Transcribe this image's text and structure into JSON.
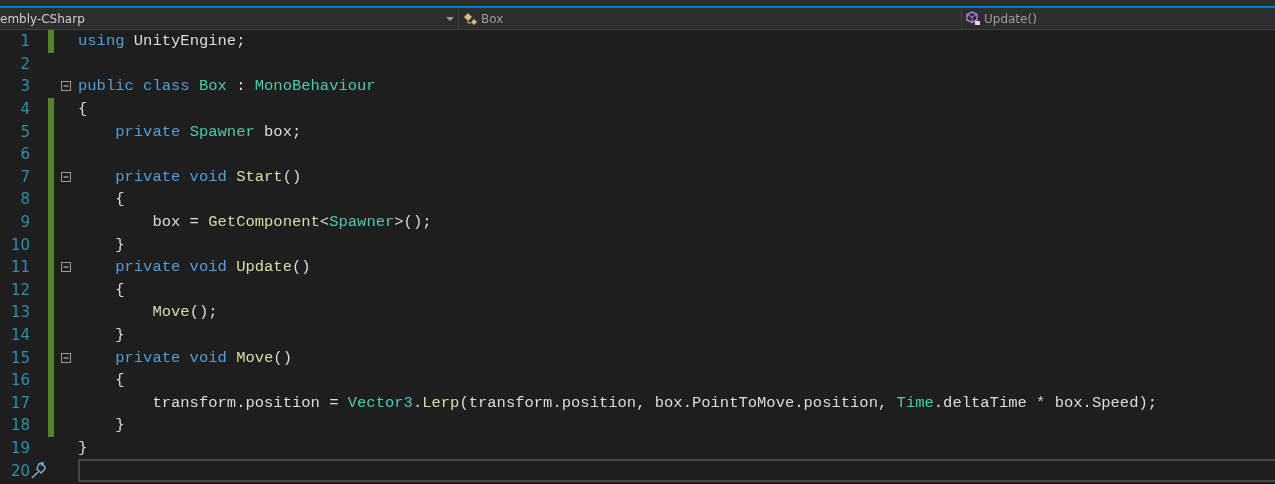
{
  "navigation_bar": {
    "dropdowns": [
      {
        "kind": "project",
        "label": "embly-CSharp"
      },
      {
        "kind": "class",
        "label": "Box"
      },
      {
        "kind": "member",
        "label": "Update()"
      }
    ]
  },
  "editor": {
    "lines": [
      {
        "number": "1",
        "changed": true,
        "fold": false,
        "current": false,
        "tokens": [
          {
            "kind": "keyword",
            "text": "using"
          },
          {
            "kind": "plain",
            "text": " UnityEngine;"
          }
        ]
      },
      {
        "number": "2",
        "changed": false,
        "fold": false,
        "current": false
      },
      {
        "number": "3",
        "changed": false,
        "fold": true,
        "current": false,
        "tokens": [
          {
            "kind": "keyword",
            "text": "public class "
          },
          {
            "kind": "type",
            "text": "Box"
          },
          {
            "kind": "plain",
            "text": " : "
          },
          {
            "kind": "type",
            "text": "MonoBehaviour"
          }
        ]
      },
      {
        "number": "4",
        "changed": true,
        "fold": false,
        "current": false,
        "tokens": [
          {
            "kind": "plain",
            "text": "{"
          }
        ]
      },
      {
        "number": "5",
        "changed": true,
        "fold": false,
        "current": false,
        "tokens": [
          {
            "kind": "keyword",
            "text": "    private "
          },
          {
            "kind": "type",
            "text": "Spawner"
          },
          {
            "kind": "plain",
            "text": " box;"
          }
        ]
      },
      {
        "number": "6",
        "changed": true,
        "fold": false,
        "current": false
      },
      {
        "number": "7",
        "changed": true,
        "fold": true,
        "current": false,
        "tokens": [
          {
            "kind": "keyword",
            "text": "    private void "
          },
          {
            "kind": "method",
            "text": "Start"
          },
          {
            "kind": "plain",
            "text": "()"
          }
        ]
      },
      {
        "number": "8",
        "changed": true,
        "fold": false,
        "current": false,
        "tokens": [
          {
            "kind": "plain",
            "text": "    {"
          }
        ]
      },
      {
        "number": "9",
        "changed": true,
        "fold": false,
        "current": false,
        "tokens": [
          {
            "kind": "plain",
            "text": "        box = "
          },
          {
            "kind": "method",
            "text": "GetComponent"
          },
          {
            "kind": "plain",
            "text": "<"
          },
          {
            "kind": "type",
            "text": "Spawner"
          },
          {
            "kind": "plain",
            "text": ">();"
          }
        ]
      },
      {
        "number": "10",
        "changed": true,
        "fold": false,
        "current": false,
        "tokens": [
          {
            "kind": "plain",
            "text": "    }"
          }
        ]
      },
      {
        "number": "11",
        "changed": true,
        "fold": true,
        "current": false,
        "tokens": [
          {
            "kind": "keyword",
            "text": "    private void "
          },
          {
            "kind": "method",
            "text": "Update"
          },
          {
            "kind": "plain",
            "text": "()"
          }
        ]
      },
      {
        "number": "12",
        "changed": true,
        "fold": false,
        "current": false,
        "tokens": [
          {
            "kind": "plain",
            "text": "    {"
          }
        ]
      },
      {
        "number": "13",
        "changed": true,
        "fold": false,
        "current": false,
        "tokens": [
          {
            "kind": "method",
            "text": "        Move"
          },
          {
            "kind": "plain",
            "text": "();"
          }
        ]
      },
      {
        "number": "14",
        "changed": true,
        "fold": false,
        "current": false,
        "tokens": [
          {
            "kind": "plain",
            "text": "    }"
          }
        ]
      },
      {
        "number": "15",
        "changed": true,
        "fold": true,
        "current": false,
        "tokens": [
          {
            "kind": "keyword",
            "text": "    private void "
          },
          {
            "kind": "method",
            "text": "Move"
          },
          {
            "kind": "plain",
            "text": "()"
          }
        ]
      },
      {
        "number": "16",
        "changed": true,
        "fold": false,
        "current": false,
        "tokens": [
          {
            "kind": "plain",
            "text": "    {"
          }
        ]
      },
      {
        "number": "17",
        "changed": true,
        "fold": false,
        "current": false,
        "tokens": [
          {
            "kind": "plain",
            "text": "        transform.position = "
          },
          {
            "kind": "type",
            "text": "Vector3"
          },
          {
            "kind": "plain",
            "text": "."
          },
          {
            "kind": "method",
            "text": "Lerp"
          },
          {
            "kind": "plain",
            "text": "(transform.position, box.PointToMove.position, "
          },
          {
            "kind": "type",
            "text": "Time"
          },
          {
            "kind": "plain",
            "text": ".deltaTime * box.Speed);"
          }
        ]
      },
      {
        "number": "18",
        "changed": true,
        "fold": false,
        "current": false,
        "tokens": [
          {
            "kind": "plain",
            "text": "    }"
          }
        ]
      },
      {
        "number": "19",
        "changed": false,
        "fold": false,
        "current": false,
        "tokens": [
          {
            "kind": "plain",
            "text": "}"
          }
        ]
      },
      {
        "number": "20",
        "changed": false,
        "fold": false,
        "current": true
      }
    ]
  }
}
